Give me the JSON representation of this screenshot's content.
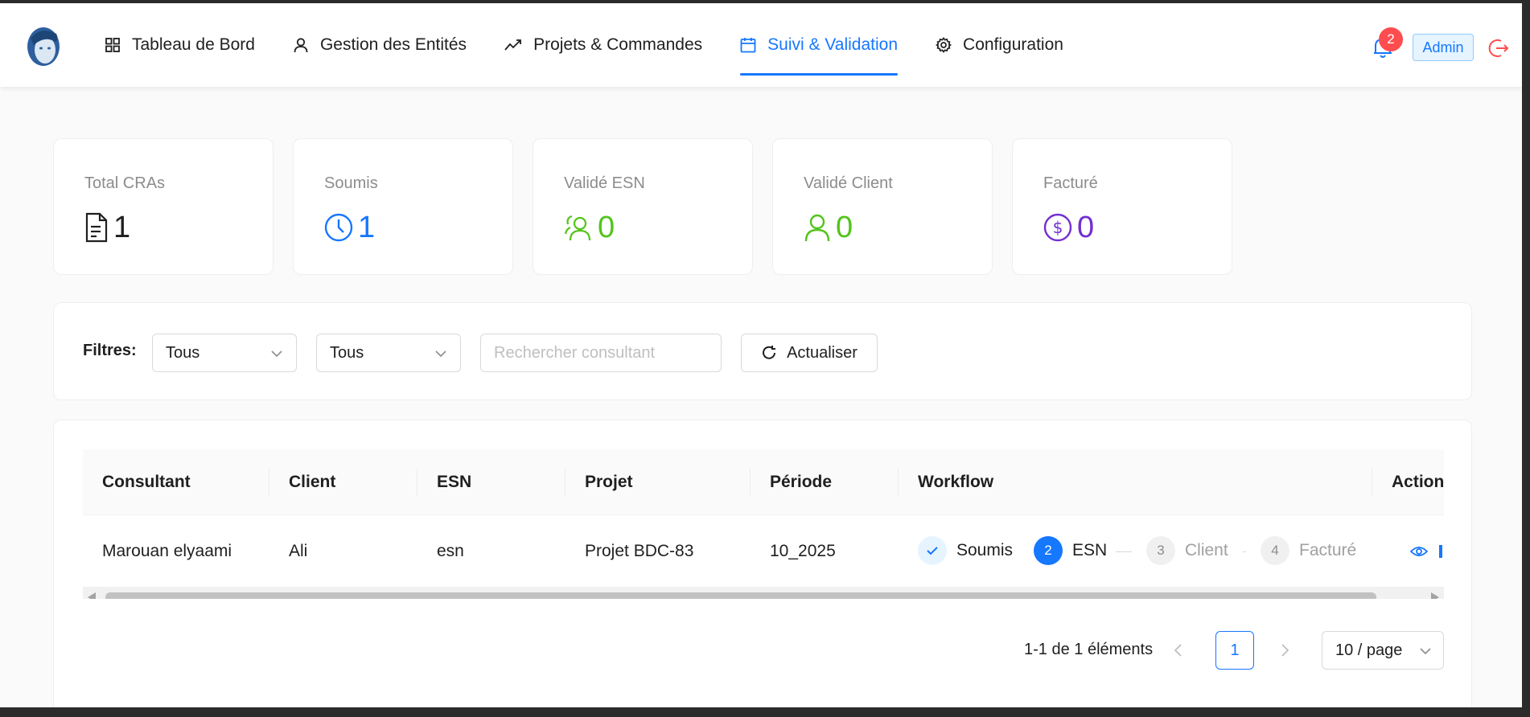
{
  "nav": {
    "items": [
      {
        "label": "Tableau de Bord",
        "icon": "dashboard-icon"
      },
      {
        "label": "Gestion des Entités",
        "icon": "user-icon"
      },
      {
        "label": "Projets & Commandes",
        "icon": "trend-icon"
      },
      {
        "label": "Suivi & Validation",
        "icon": "calendar-icon",
        "active": true
      },
      {
        "label": "Configuration",
        "icon": "gear-icon"
      }
    ]
  },
  "header": {
    "notification_count": "2",
    "user_role": "Admin"
  },
  "stats": [
    {
      "label": "Total CRAs",
      "value": "1",
      "icon": "file-text-icon",
      "color": "#1f1f1f"
    },
    {
      "label": "Soumis",
      "value": "1",
      "icon": "clock-icon",
      "color": "#1677ff"
    },
    {
      "label": "Validé ESN",
      "value": "0",
      "icon": "team-icon",
      "color": "#52c41a"
    },
    {
      "label": "Validé Client",
      "value": "0",
      "icon": "user-icon",
      "color": "#52c41a"
    },
    {
      "label": "Facturé",
      "value": "0",
      "icon": "dollar-icon",
      "color": "#722ed1"
    }
  ],
  "filters": {
    "label": "Filtres:",
    "select1": "Tous",
    "select2": "Tous",
    "search_placeholder": "Rechercher consultant",
    "refresh_label": "Actualiser"
  },
  "table": {
    "columns": [
      "Consultant",
      "Client",
      "ESN",
      "Projet",
      "Période",
      "Workflow",
      "Action"
    ],
    "rows": [
      {
        "consultant": "Marouan elyaami",
        "client": "Ali",
        "esn": "esn",
        "projet": "Projet BDC-83",
        "periode": "10_2025",
        "workflow": [
          {
            "label": "Soumis",
            "num": "",
            "state": "done"
          },
          {
            "label": "ESN",
            "num": "2",
            "state": "current"
          },
          {
            "label": "Client",
            "num": "3",
            "state": "wait"
          },
          {
            "label": "Facturé",
            "num": "4",
            "state": "wait"
          }
        ]
      }
    ]
  },
  "pagination": {
    "total_text": "1-1 de 1 éléments",
    "current_page": "1",
    "page_size": "10 / page"
  },
  "colors": {
    "primary": "#1677ff",
    "success": "#52c41a",
    "purple": "#722ed1",
    "danger": "#ff4d4f"
  }
}
